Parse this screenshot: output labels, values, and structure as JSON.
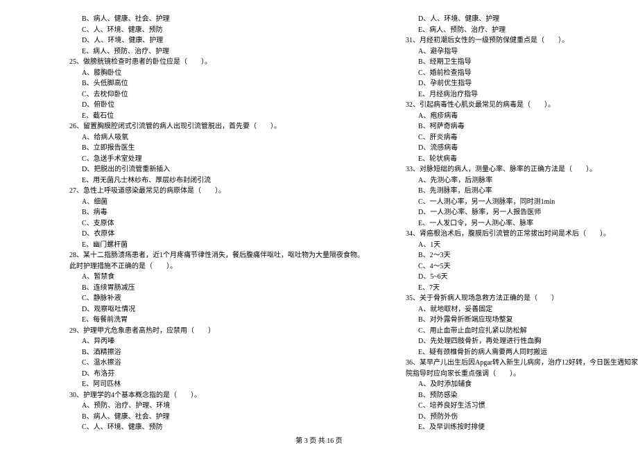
{
  "footer": "第 3 页 共 16 页",
  "left": [
    {
      "t": "B、病人、健康、社会、护理",
      "c": "indent-1"
    },
    {
      "t": "C、人、环境、健康、预防",
      "c": "indent-1"
    },
    {
      "t": "D、人、环境、健康、护理",
      "c": "indent-1"
    },
    {
      "t": "E、病人、预防、治疗、护理",
      "c": "indent-1"
    },
    {
      "t": "25、做膀胱镜检查时患者的卧位应是（　　）。",
      "c": "indent-0"
    },
    {
      "t": "A、膝胸卧位",
      "c": "indent-1"
    },
    {
      "t": "B、头低脚高位",
      "c": "indent-1"
    },
    {
      "t": "C、去枕仰卧位",
      "c": "indent-1"
    },
    {
      "t": "D、俯卧位",
      "c": "indent-1"
    },
    {
      "t": "E、截石位",
      "c": "indent-1"
    },
    {
      "t": "26、留置胸膜腔闭式引流管的病人出现引流管脱出，首先要（　　）。",
      "c": "indent-0"
    },
    {
      "t": "A、给病人吸氧",
      "c": "indent-1"
    },
    {
      "t": "B、立即报告医生",
      "c": "indent-1"
    },
    {
      "t": "C、急送手术室处理",
      "c": "indent-1"
    },
    {
      "t": "D、把脱出的引流管重新插入",
      "c": "indent-1"
    },
    {
      "t": "E、用无菌凡士林纱布、厚层纱布封闭引流",
      "c": "indent-1"
    },
    {
      "t": "27、急性上呼吸道感染最常见的病原体是（　　）。",
      "c": "indent-0"
    },
    {
      "t": "A、细菌",
      "c": "indent-1"
    },
    {
      "t": "B、病毒",
      "c": "indent-1"
    },
    {
      "t": "C、支原体",
      "c": "indent-1"
    },
    {
      "t": "D、衣原体",
      "c": "indent-1"
    },
    {
      "t": "E、幽门螺杆菌",
      "c": "indent-1"
    },
    {
      "t": "28、某十二指肠溃疡患者，近1个月疼痛节律性消失，餐后腹痛伴呕吐，呕吐物为大量隔夜食物。",
      "c": "indent-0"
    },
    {
      "t": "此时护理措施不正确的是（　　）。",
      "c": "indent-0"
    },
    {
      "t": "A、暂禁食",
      "c": "indent-1"
    },
    {
      "t": "B、连续胃肠减压",
      "c": "indent-1"
    },
    {
      "t": "C、静脉补液",
      "c": "indent-1"
    },
    {
      "t": "D、观察呕吐情况",
      "c": "indent-1"
    },
    {
      "t": "E、每餐前洗胃",
      "c": "indent-1"
    },
    {
      "t": "29、护理甲亢危象患者高热时，应禁用（　　）",
      "c": "indent-0"
    },
    {
      "t": "A、异丙嗪",
      "c": "indent-1"
    },
    {
      "t": "B、酒精擦浴",
      "c": "indent-1"
    },
    {
      "t": "C、温水擦浴",
      "c": "indent-1"
    },
    {
      "t": "D、布洛芬",
      "c": "indent-1"
    },
    {
      "t": "E、阿司匹林",
      "c": "indent-1"
    },
    {
      "t": "30、护理学的4个基本概念指的是（　　）。",
      "c": "indent-0"
    },
    {
      "t": "A、预防、治疗、护理、环境",
      "c": "indent-1"
    },
    {
      "t": "B、病人、健康、社会、护理",
      "c": "indent-1"
    },
    {
      "t": "C、人、环境、健康、预防",
      "c": "indent-1"
    }
  ],
  "right": [
    {
      "t": "D、人、环境、健康、护理",
      "c": "indent-1"
    },
    {
      "t": "E、病人、预防、治疗、护理",
      "c": "indent-1"
    },
    {
      "t": "31、月经初潮后女性的一级预防保健重点是（　　）。",
      "c": "indent-0"
    },
    {
      "t": "A、避孕指导",
      "c": "indent-1"
    },
    {
      "t": "B、经期卫生指导",
      "c": "indent-1"
    },
    {
      "t": "C、婚前检查指导",
      "c": "indent-1"
    },
    {
      "t": "D、孕前优生指导",
      "c": "indent-1"
    },
    {
      "t": "E、月经病治疗指导",
      "c": "indent-1"
    },
    {
      "t": "32、引起病毒性心肌炎最常见的病毒是（　　）。",
      "c": "indent-0"
    },
    {
      "t": "A、疱疹病毒",
      "c": "indent-1"
    },
    {
      "t": "B、柯萨奇病毒",
      "c": "indent-1"
    },
    {
      "t": "C、肝炎病毒",
      "c": "indent-1"
    },
    {
      "t": "D、流感病毒",
      "c": "indent-1"
    },
    {
      "t": "E、轮状病毒",
      "c": "indent-1"
    },
    {
      "t": "33、对脉短绌的病人，测量心率、脉率的正确方法是（　　）。",
      "c": "indent-0"
    },
    {
      "t": "A、先测心率，后测脉率",
      "c": "indent-1"
    },
    {
      "t": "B、先测脉率，后测心率",
      "c": "indent-1"
    },
    {
      "t": "C、一人测心率，另一人测脉率，同时测1min",
      "c": "indent-1"
    },
    {
      "t": "D、一人测心率、脉率，另一人报告医师",
      "c": "indent-1"
    },
    {
      "t": "E、一人发口令，另一人测心率、脉率",
      "c": "indent-1"
    },
    {
      "t": "34、肾癌根治术后，腹膜后引流管的正常拔出时间是术后（　　）。",
      "c": "indent-0"
    },
    {
      "t": "A、1天",
      "c": "indent-1"
    },
    {
      "t": "B、2～3天",
      "c": "indent-1"
    },
    {
      "t": "C、4～5天",
      "c": "indent-1"
    },
    {
      "t": "D、5~6天",
      "c": "indent-1"
    },
    {
      "t": "E、7天",
      "c": "indent-1"
    },
    {
      "t": "35、关于骨折病人现场急救方法正确的是（　　）",
      "c": "indent-0"
    },
    {
      "t": "A、就地取材，妥善固定",
      "c": "indent-1"
    },
    {
      "t": "B、对外露骨折断端应现场整复",
      "c": "indent-1"
    },
    {
      "t": "C、用止血带止血时应扎紧以防松解",
      "c": "indent-1"
    },
    {
      "t": "D、先处理四肢骨折，再处理进行性血胸",
      "c": "indent-1"
    },
    {
      "t": "E、疑有颈椎骨折的病人需要两人同时搬运",
      "c": "indent-1"
    },
    {
      "t": "36、某早产儿出生后因Apgar转入新生儿病房，治疗12好转，今日医生遇知家长出院，护士在出",
      "c": "indent-0"
    },
    {
      "t": "院指导时应向家长重点强调（　　）。",
      "c": "indent-0"
    },
    {
      "t": "A、及时添加辅食",
      "c": "indent-1"
    },
    {
      "t": "B、预防感染",
      "c": "indent-1"
    },
    {
      "t": "C、培养良好生活习惯",
      "c": "indent-1"
    },
    {
      "t": "D、预防外伤",
      "c": "indent-1"
    },
    {
      "t": "E、及早训练按时排便",
      "c": "indent-1"
    }
  ]
}
